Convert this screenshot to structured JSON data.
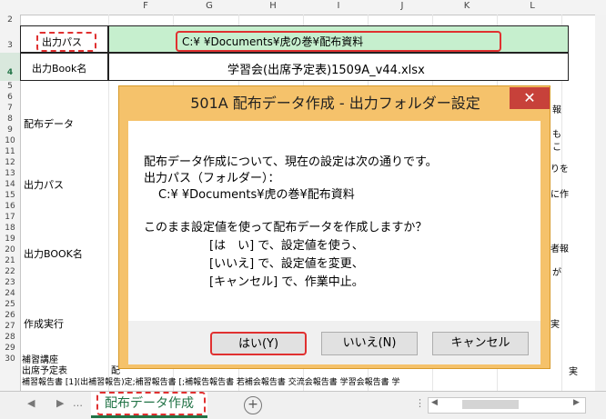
{
  "columns": [
    "F",
    "G",
    "H",
    "I",
    "J",
    "K",
    "L"
  ],
  "rows": [
    "2",
    "3",
    "4",
    "5",
    "6",
    "7",
    "8",
    "9",
    "10",
    "11",
    "12",
    "13",
    "14",
    "15",
    "16",
    "17",
    "18",
    "19",
    "20",
    "21",
    "22",
    "23",
    "24",
    "25",
    "26",
    "27",
    "28",
    "29",
    "30"
  ],
  "sheet": {
    "path_label": "出力パス",
    "path_value": "C:¥                    ¥Documents¥虎の巻¥配布資料",
    "book_label": "出力Book名",
    "book_value": "学習会(出席予定表)1509A_v44.xlsx",
    "section_distribution": "配布データ",
    "section_output_path": "出力パス",
    "section_output_book": "出力BOOK名",
    "section_execute": "作成実行",
    "row28": "補習講座",
    "row29_label": "出席予定表",
    "row29_text": "配",
    "row30": "補習報告書 [1](出補習報告)定;補習報告書 [;補報告報告書 若補会報告書 交流会報告書 学習会報告書 学",
    "right_fragments": [
      "報",
      "も",
      "こ",
      "りを",
      "に作",
      "者報",
      "が",
      "実",
      "実"
    ]
  },
  "dialog": {
    "title": "501A 配布データ作成 - 出力フォルダー設定",
    "close": "✕",
    "line1": "配布データ作成について、現在の設定は次の通りです。",
    "line2": "出力パス（フォルダー）：",
    "line3": "C:¥                    ¥Documents¥虎の巻¥配布資料",
    "line4": "このまま設定値を使って配布データを作成しますか？",
    "line5": "[は　い] で、設定値を使う、",
    "line6": "[いいえ] で、設定値を変更、",
    "line7": "[キャンセル] で、作業中止。",
    "yes": "はい(Y)",
    "no": "いいえ(N)",
    "cancel": "キャンセル"
  },
  "tabs": {
    "active": "配布データ作成",
    "add": "+"
  }
}
